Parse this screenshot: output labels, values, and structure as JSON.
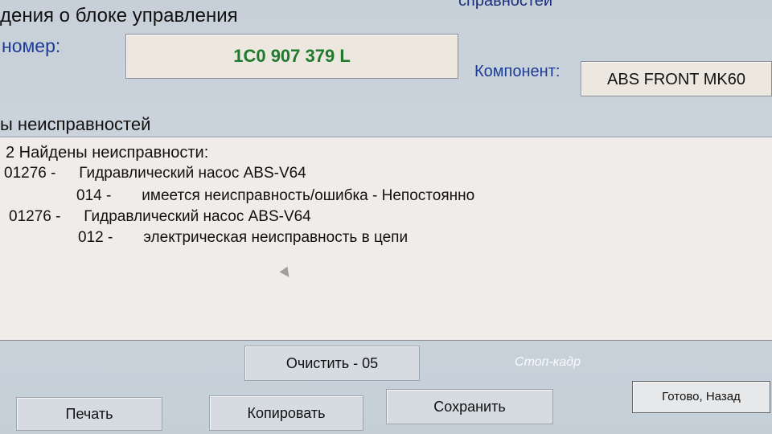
{
  "top_right_partial": "справностей",
  "section_title": "дения о блоке управления",
  "number_label": "номер:",
  "part_number": "1C0 907 379 L",
  "component_label": "Компонент:",
  "component_value": "ABS FRONT MK60",
  "faults_title": "ы неисправностей",
  "fault_header": "2 Найдены неисправности:",
  "faults": [
    {
      "code": "01276 -",
      "description": "Гидравлический насос ABS-V64",
      "subcode": "014 -",
      "subdescription": "имеется неисправность/ошибка - Непостоянно"
    },
    {
      "code": "01276 -",
      "description": "Гидравлический насос ABS-V64",
      "subcode": "012 -",
      "subdescription": "электрическая неисправность в цепи"
    }
  ],
  "buttons": {
    "clear": "Очистить - 05",
    "freeze_frame": "Стоп-кадр",
    "print": "Печать",
    "copy": "Копировать",
    "save": "Сохранить",
    "done_back": "Готово, Назад"
  }
}
